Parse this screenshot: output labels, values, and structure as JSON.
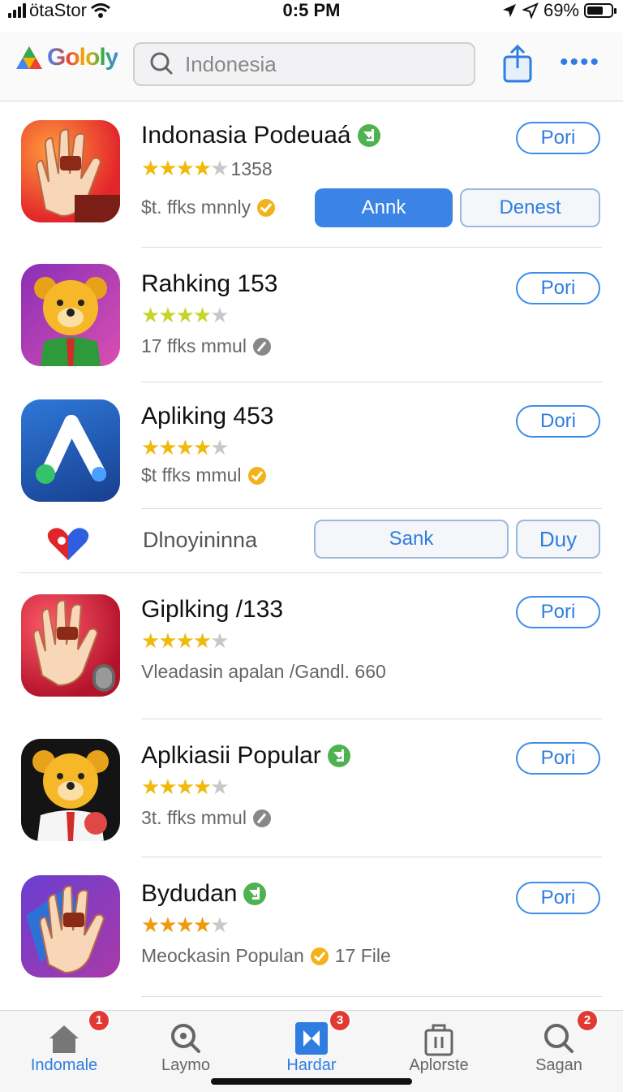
{
  "status_bar": {
    "carrier": "ötaStor",
    "time": "0:5 PM",
    "battery": "69%",
    "battery_level": 0.69,
    "icons": [
      "signal-icon",
      "wifi-icon",
      "location-icon",
      "battery-icon"
    ]
  },
  "header": {
    "logo_text": "Gololy",
    "search_placeholder": "Indonesia",
    "icons": [
      "share-icon",
      "more-icon"
    ],
    "more_label": "••••"
  },
  "apps": [
    {
      "title": "Indonasia Podeuaá",
      "verified": true,
      "rating": 4,
      "rating_count": "1358",
      "subtitle": "$t. ffks mnnly",
      "subtitle_badge": "yellow-check",
      "button": "Pori",
      "actions": [
        "Annk",
        "Denest"
      ]
    },
    {
      "title": "Rahking 153",
      "verified": false,
      "rating": 4,
      "rating_count": "",
      "subtitle": "17 ffks mmul",
      "subtitle_badge": "gray",
      "button": "Pori"
    },
    {
      "title": "Apliking 453",
      "verified": false,
      "rating": 4,
      "rating_count": "",
      "subtitle": "$t ffks mmul",
      "subtitle_badge": "yellow-check",
      "button": "Dori"
    },
    {
      "title": "Giplking /133",
      "verified": false,
      "rating": 4,
      "rating_count": "",
      "subtitle": "Vleadasin apalan /Gandl. 660",
      "subtitle_badge": "",
      "button": "Pori"
    },
    {
      "title": "Aplkiasii Popular",
      "verified": true,
      "rating": 4,
      "rating_count": "",
      "subtitle": "3t. ffks mmul",
      "subtitle_badge": "gray",
      "button": "Pori"
    },
    {
      "title": "Bydudan",
      "verified": true,
      "rating": 4,
      "rating_count": "",
      "subtitle": "Meockasin Populan",
      "subtitle_extra": "17 File",
      "subtitle_badge": "yellow-check",
      "button": "Pori"
    }
  ],
  "promo": {
    "label": "Dlnoyininna",
    "icon": "heart-icon",
    "actions": [
      "Sank",
      "Duy"
    ]
  },
  "tabs": [
    {
      "label": "Indomale",
      "icon": "home-icon",
      "badge": "1",
      "active": true
    },
    {
      "label": "Laymo",
      "icon": "search-icon",
      "badge": "",
      "active": false
    },
    {
      "label": "Hardar",
      "icon": "play-box-icon",
      "badge": "3",
      "active": true
    },
    {
      "label": "Aplorste",
      "icon": "bag-icon",
      "badge": "",
      "active": false
    },
    {
      "label": "Sagan",
      "icon": "search-icon",
      "badge": "2",
      "active": false
    }
  ],
  "colors": {
    "accent": "#2f7de1",
    "star": "#f0b90b",
    "badge_red": "#e03a33",
    "verified_green": "#4db24f"
  }
}
